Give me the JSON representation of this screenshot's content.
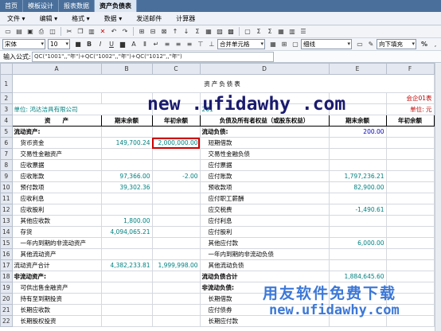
{
  "tabs": [
    "首页",
    "模板设计",
    "报表数据",
    "资产负债表"
  ],
  "active_tab": 3,
  "menu": [
    "文件 ▾",
    "编辑 ▾",
    "格式 ▾",
    "数据 ▾",
    "发送邮件",
    "计算器"
  ],
  "toolbar": {
    "font": "宋体",
    "size": "10",
    "merge": "合并单元格",
    "border": "细线",
    "fill": "向下填充",
    "bold": "B",
    "italic": "I",
    "underline": "U",
    "percent": "%"
  },
  "formula": {
    "label": "输入公式:",
    "value": "QC(\"1001\",,\"年\")+QC(\"1002\",,\"年\")+QC(\"1012\",,\"年\")"
  },
  "columns": [
    "A",
    "B",
    "C",
    "D",
    "E",
    "F"
  ],
  "rows": [
    "1",
    "2",
    "3",
    "4",
    "5",
    "6",
    "7",
    "8",
    "9",
    "10",
    "11",
    "12",
    "13",
    "14",
    "15",
    "16",
    "17",
    "18",
    "19",
    "20",
    "21",
    "22"
  ],
  "sheet": {
    "title": "资产负债表",
    "form_no": "会企01表",
    "unit_label": "单位:",
    "company": "单位: 鸿达洁具有限公司",
    "date": "201",
    "unit_value": "单位: 元",
    "h_asset": "资　　产",
    "h_end": "期末余额",
    "h_begin": "年初余额",
    "h_liab": "负债及所有者权益（或股东权益）",
    "h_end2": "期末余额",
    "h_begin2": "年初余额",
    "body": [
      [
        "流动资产:",
        "",
        "",
        "流动负债:",
        "200.00",
        ""
      ],
      [
        "货币资金",
        "149,700.24",
        "2,000,000.00",
        "短期借款",
        "",
        ""
      ],
      [
        "交易性金融资产",
        "",
        "",
        "交易性金融负债",
        "",
        ""
      ],
      [
        "应收票据",
        "",
        "",
        "应付票据",
        "",
        ""
      ],
      [
        "应收账款",
        "97,366.00",
        "-2.00",
        "应付账款",
        "1,797,236.21",
        ""
      ],
      [
        "预付款项",
        "39,302.36",
        "",
        "预收款项",
        "82,900.00",
        ""
      ],
      [
        "应收利息",
        "",
        "",
        "应付职工薪酬",
        "",
        ""
      ],
      [
        "应收股利",
        "",
        "",
        "应交税费",
        "-1,490.61",
        ""
      ],
      [
        "其他应收款",
        "1,800.00",
        "",
        "应付利息",
        "",
        ""
      ],
      [
        "存货",
        "4,094,065.21",
        "",
        "应付股利",
        "",
        ""
      ],
      [
        "一年内到期的非流动资产",
        "",
        "",
        "其他应付款",
        "6,000.00",
        ""
      ],
      [
        "其他流动资产",
        "",
        "",
        "一年内到期的非流动负债",
        "",
        ""
      ],
      [
        "流动资产合计",
        "4,382,233.81",
        "1,999,998.00",
        "其他流动负债",
        "",
        ""
      ],
      [
        "非流动资产:",
        "",
        "",
        "流动负债合计",
        "1,884,645.60",
        ""
      ],
      [
        "可供出售金融资产",
        "",
        "",
        "非流动负债:",
        "",
        ""
      ],
      [
        "持有至到期投资",
        "",
        "",
        "长期借款",
        "",
        ""
      ],
      [
        "长期应收款",
        "",
        "",
        "应付债券",
        "",
        ""
      ],
      [
        "长期股权投资",
        "",
        "",
        "长期应付款",
        "",
        ""
      ]
    ]
  },
  "watermark": {
    "top": "new .ufidawhy .com",
    "bottom_cn": "用友软件免费下载",
    "bottom_en": "new.ufidawhy.com"
  }
}
